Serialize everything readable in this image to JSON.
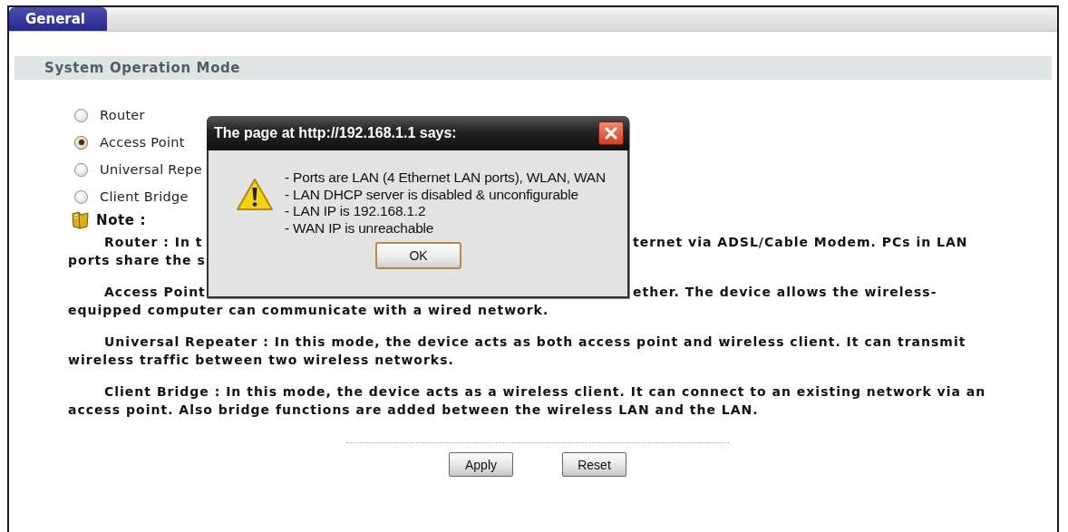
{
  "tabs": [
    {
      "label": "General",
      "selected": true
    }
  ],
  "section": {
    "title": "System Operation Mode"
  },
  "modes": [
    {
      "label": "Router",
      "selected": false
    },
    {
      "label": "Access Point",
      "selected": true
    },
    {
      "label": "Universal Repe",
      "selected": false
    },
    {
      "label": "Client Bridge",
      "selected": false
    }
  ],
  "note": {
    "title": "Note :",
    "paragraphs": [
      {
        "kind": "split",
        "lines": [
          {
            "left": "Router : In t",
            "right": "ternet via ADSL/Cable Modem. PCs in LAN"
          },
          {
            "left": "ports share the s"
          }
        ]
      },
      {
        "kind": "split",
        "lines": [
          {
            "left": "Access Point",
            "right": "ether. The device allows the wireless-"
          },
          {
            "left": "equipped computer can communicate with a wired network."
          }
        ]
      },
      {
        "kind": "full",
        "text": "Universal Repeater : In this mode, the device acts as both access point and wireless client. It can transmit wireless traffic between two wireless networks."
      },
      {
        "kind": "full",
        "text": "Client Bridge : In this mode, the device acts as a wireless client. It can connect to an existing network via an access point. Also bridge functions are added between the wireless LAN and the LAN."
      }
    ]
  },
  "buttons": [
    "Apply",
    "Reset"
  ],
  "dialog": {
    "title": "The page at http://192.168.1.1 says:",
    "lines": [
      "- Ports are LAN (4 Ethernet LAN ports), WLAN, WAN",
      "- LAN DHCP server is disabled & unconfigurable",
      "- LAN IP is 192.168.1.2",
      "- WAN IP is unreachable"
    ],
    "button": "OK"
  }
}
